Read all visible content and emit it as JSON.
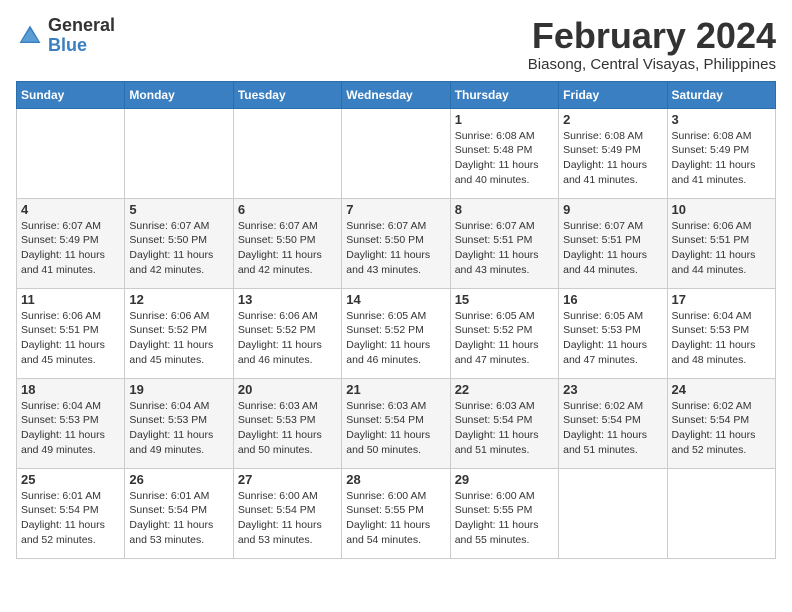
{
  "header": {
    "logo_general": "General",
    "logo_blue": "Blue",
    "month_title": "February 2024",
    "location": "Biasong, Central Visayas, Philippines"
  },
  "days_of_week": [
    "Sunday",
    "Monday",
    "Tuesday",
    "Wednesday",
    "Thursday",
    "Friday",
    "Saturday"
  ],
  "weeks": [
    [
      {
        "day": "",
        "info": ""
      },
      {
        "day": "",
        "info": ""
      },
      {
        "day": "",
        "info": ""
      },
      {
        "day": "",
        "info": ""
      },
      {
        "day": "1",
        "info": "Sunrise: 6:08 AM\nSunset: 5:48 PM\nDaylight: 11 hours and 40 minutes."
      },
      {
        "day": "2",
        "info": "Sunrise: 6:08 AM\nSunset: 5:49 PM\nDaylight: 11 hours and 41 minutes."
      },
      {
        "day": "3",
        "info": "Sunrise: 6:08 AM\nSunset: 5:49 PM\nDaylight: 11 hours and 41 minutes."
      }
    ],
    [
      {
        "day": "4",
        "info": "Sunrise: 6:07 AM\nSunset: 5:49 PM\nDaylight: 11 hours and 41 minutes."
      },
      {
        "day": "5",
        "info": "Sunrise: 6:07 AM\nSunset: 5:50 PM\nDaylight: 11 hours and 42 minutes."
      },
      {
        "day": "6",
        "info": "Sunrise: 6:07 AM\nSunset: 5:50 PM\nDaylight: 11 hours and 42 minutes."
      },
      {
        "day": "7",
        "info": "Sunrise: 6:07 AM\nSunset: 5:50 PM\nDaylight: 11 hours and 43 minutes."
      },
      {
        "day": "8",
        "info": "Sunrise: 6:07 AM\nSunset: 5:51 PM\nDaylight: 11 hours and 43 minutes."
      },
      {
        "day": "9",
        "info": "Sunrise: 6:07 AM\nSunset: 5:51 PM\nDaylight: 11 hours and 44 minutes."
      },
      {
        "day": "10",
        "info": "Sunrise: 6:06 AM\nSunset: 5:51 PM\nDaylight: 11 hours and 44 minutes."
      }
    ],
    [
      {
        "day": "11",
        "info": "Sunrise: 6:06 AM\nSunset: 5:51 PM\nDaylight: 11 hours and 45 minutes."
      },
      {
        "day": "12",
        "info": "Sunrise: 6:06 AM\nSunset: 5:52 PM\nDaylight: 11 hours and 45 minutes."
      },
      {
        "day": "13",
        "info": "Sunrise: 6:06 AM\nSunset: 5:52 PM\nDaylight: 11 hours and 46 minutes."
      },
      {
        "day": "14",
        "info": "Sunrise: 6:05 AM\nSunset: 5:52 PM\nDaylight: 11 hours and 46 minutes."
      },
      {
        "day": "15",
        "info": "Sunrise: 6:05 AM\nSunset: 5:52 PM\nDaylight: 11 hours and 47 minutes."
      },
      {
        "day": "16",
        "info": "Sunrise: 6:05 AM\nSunset: 5:53 PM\nDaylight: 11 hours and 47 minutes."
      },
      {
        "day": "17",
        "info": "Sunrise: 6:04 AM\nSunset: 5:53 PM\nDaylight: 11 hours and 48 minutes."
      }
    ],
    [
      {
        "day": "18",
        "info": "Sunrise: 6:04 AM\nSunset: 5:53 PM\nDaylight: 11 hours and 49 minutes."
      },
      {
        "day": "19",
        "info": "Sunrise: 6:04 AM\nSunset: 5:53 PM\nDaylight: 11 hours and 49 minutes."
      },
      {
        "day": "20",
        "info": "Sunrise: 6:03 AM\nSunset: 5:53 PM\nDaylight: 11 hours and 50 minutes."
      },
      {
        "day": "21",
        "info": "Sunrise: 6:03 AM\nSunset: 5:54 PM\nDaylight: 11 hours and 50 minutes."
      },
      {
        "day": "22",
        "info": "Sunrise: 6:03 AM\nSunset: 5:54 PM\nDaylight: 11 hours and 51 minutes."
      },
      {
        "day": "23",
        "info": "Sunrise: 6:02 AM\nSunset: 5:54 PM\nDaylight: 11 hours and 51 minutes."
      },
      {
        "day": "24",
        "info": "Sunrise: 6:02 AM\nSunset: 5:54 PM\nDaylight: 11 hours and 52 minutes."
      }
    ],
    [
      {
        "day": "25",
        "info": "Sunrise: 6:01 AM\nSunset: 5:54 PM\nDaylight: 11 hours and 52 minutes."
      },
      {
        "day": "26",
        "info": "Sunrise: 6:01 AM\nSunset: 5:54 PM\nDaylight: 11 hours and 53 minutes."
      },
      {
        "day": "27",
        "info": "Sunrise: 6:00 AM\nSunset: 5:54 PM\nDaylight: 11 hours and 53 minutes."
      },
      {
        "day": "28",
        "info": "Sunrise: 6:00 AM\nSunset: 5:55 PM\nDaylight: 11 hours and 54 minutes."
      },
      {
        "day": "29",
        "info": "Sunrise: 6:00 AM\nSunset: 5:55 PM\nDaylight: 11 hours and 55 minutes."
      },
      {
        "day": "",
        "info": ""
      },
      {
        "day": "",
        "info": ""
      }
    ]
  ]
}
